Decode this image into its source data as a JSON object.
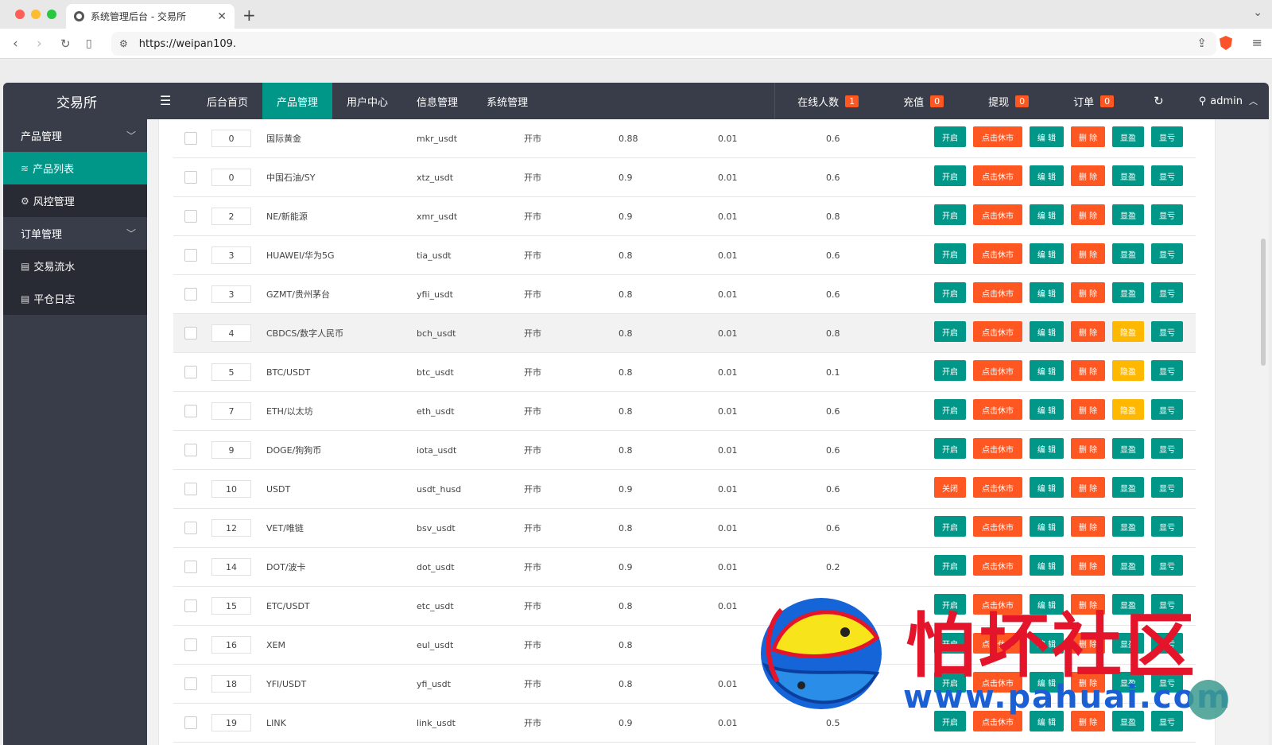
{
  "browser": {
    "tab_title": "系统管理后台 - 交易所",
    "url": "https://weipan109."
  },
  "app": {
    "logo": "交易所",
    "topnav": [
      "后台首页",
      "产品管理",
      "用户中心",
      "信息管理",
      "系统管理"
    ],
    "stats": [
      {
        "label": "在线人数",
        "count": "1"
      },
      {
        "label": "充值",
        "count": "0"
      },
      {
        "label": "提现",
        "count": "0"
      },
      {
        "label": "订单",
        "count": "0"
      }
    ],
    "user": "admin"
  },
  "sidebar": {
    "product_group": "产品管理",
    "product_list": "产品列表",
    "risk": "风控管理",
    "order_group": "订单管理",
    "trade_flow": "交易流水",
    "close_log": "平仓日志"
  },
  "buttons": {
    "open": "开启",
    "close": "关闭",
    "rest": "点击休市",
    "edit": "编 辑",
    "delete": "删 除",
    "show_profit": "显盈",
    "hide_profit": "隐盈",
    "show_loss": "显亏"
  },
  "rows": [
    {
      "sort": "0",
      "name": "国际黄金",
      "code": "mkr_usdt",
      "mode": "开市",
      "v1": "0.88",
      "v2": "0.01",
      "v3": "0.6",
      "status": "open",
      "profit": "show"
    },
    {
      "sort": "0",
      "name": "中国石油/SY",
      "code": "xtz_usdt",
      "mode": "开市",
      "v1": "0.9",
      "v2": "0.01",
      "v3": "0.6",
      "status": "open",
      "profit": "show"
    },
    {
      "sort": "2",
      "name": "NE/新能源",
      "code": "xmr_usdt",
      "mode": "开市",
      "v1": "0.9",
      "v2": "0.01",
      "v3": "0.8",
      "status": "open",
      "profit": "show"
    },
    {
      "sort": "3",
      "name": "HUAWEI/华为5G",
      "code": "tia_usdt",
      "mode": "开市",
      "v1": "0.8",
      "v2": "0.01",
      "v3": "0.6",
      "status": "open",
      "profit": "show"
    },
    {
      "sort": "3",
      "name": "GZMT/贵州茅台",
      "code": "yfii_usdt",
      "mode": "开市",
      "v1": "0.8",
      "v2": "0.01",
      "v3": "0.6",
      "status": "open",
      "profit": "show"
    },
    {
      "sort": "4",
      "name": "CBDCS/数字人民币",
      "code": "bch_usdt",
      "mode": "开市",
      "v1": "0.8",
      "v2": "0.01",
      "v3": "0.8",
      "status": "open",
      "profit": "hide"
    },
    {
      "sort": "5",
      "name": "BTC/USDT",
      "code": "btc_usdt",
      "mode": "开市",
      "v1": "0.8",
      "v2": "0.01",
      "v3": "0.1",
      "status": "open",
      "profit": "hide"
    },
    {
      "sort": "7",
      "name": "ETH/以太坊",
      "code": "eth_usdt",
      "mode": "开市",
      "v1": "0.8",
      "v2": "0.01",
      "v3": "0.6",
      "status": "open",
      "profit": "hide"
    },
    {
      "sort": "9",
      "name": "DOGE/狗狗币",
      "code": "iota_usdt",
      "mode": "开市",
      "v1": "0.8",
      "v2": "0.01",
      "v3": "0.6",
      "status": "open",
      "profit": "show"
    },
    {
      "sort": "10",
      "name": "USDT",
      "code": "usdt_husd",
      "mode": "开市",
      "v1": "0.9",
      "v2": "0.01",
      "v3": "0.6",
      "status": "closed",
      "profit": "show"
    },
    {
      "sort": "12",
      "name": "VET/唯链",
      "code": "bsv_usdt",
      "mode": "开市",
      "v1": "0.8",
      "v2": "0.01",
      "v3": "0.6",
      "status": "open",
      "profit": "show"
    },
    {
      "sort": "14",
      "name": "DOT/波卡",
      "code": "dot_usdt",
      "mode": "开市",
      "v1": "0.9",
      "v2": "0.01",
      "v3": "0.2",
      "status": "open",
      "profit": "show"
    },
    {
      "sort": "15",
      "name": "ETC/USDT",
      "code": "etc_usdt",
      "mode": "开市",
      "v1": "0.8",
      "v2": "0.01",
      "v3": "",
      "status": "open",
      "profit": "show"
    },
    {
      "sort": "16",
      "name": "XEM",
      "code": "eul_usdt",
      "mode": "开市",
      "v1": "0.8",
      "v2": "",
      "v3": "",
      "status": "open",
      "profit": "show"
    },
    {
      "sort": "18",
      "name": "YFI/USDT",
      "code": "yfi_usdt",
      "mode": "开市",
      "v1": "0.8",
      "v2": "0.01",
      "v3": "",
      "status": "open",
      "profit": "show"
    },
    {
      "sort": "19",
      "name": "LINK",
      "code": "link_usdt",
      "mode": "开市",
      "v1": "0.9",
      "v2": "0.01",
      "v3": "0.5",
      "status": "open",
      "profit": "show"
    }
  ],
  "watermark": {
    "title": "怕坏社区",
    "url": "www.pahuai.com"
  }
}
